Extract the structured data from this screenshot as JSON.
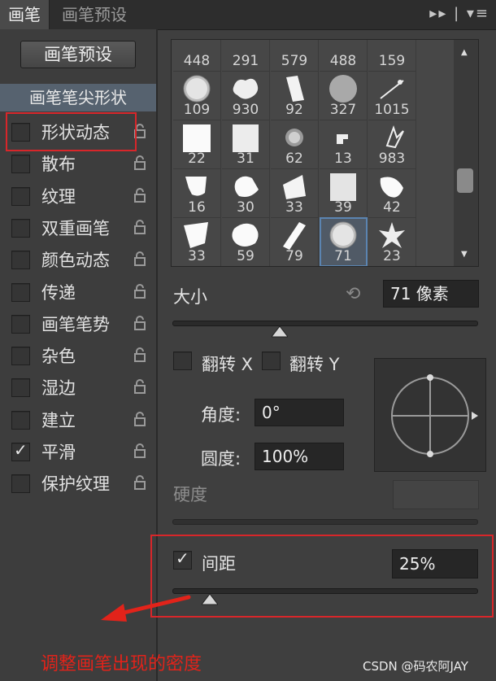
{
  "tabs": [
    "画笔",
    "画笔预设"
  ],
  "panel_controls": "▸▸ | ▾≡",
  "preset_button": "画笔预设",
  "tip_header": "画笔笔尖形状",
  "options": [
    {
      "label": "形状动态",
      "checked": false
    },
    {
      "label": "散布",
      "checked": false
    },
    {
      "label": "纹理",
      "checked": false
    },
    {
      "label": "双重画笔",
      "checked": false
    },
    {
      "label": "颜色动态",
      "checked": false
    },
    {
      "label": "传递",
      "checked": false
    },
    {
      "label": "画笔笔势",
      "checked": false
    },
    {
      "label": "杂色",
      "checked": false
    },
    {
      "label": "湿边",
      "checked": false
    },
    {
      "label": "建立",
      "checked": false
    },
    {
      "label": "平滑",
      "checked": true
    },
    {
      "label": "保护纹理",
      "checked": false
    }
  ],
  "brushes": [
    "448",
    "291",
    "579",
    "488",
    "159",
    "109",
    "930",
    "92",
    "327",
    "1015",
    "22",
    "31",
    "62",
    "13",
    "983",
    "16",
    "30",
    "33",
    "39",
    "42",
    "33",
    "59",
    "79",
    "71",
    "23"
  ],
  "selected_brush": "71",
  "size": {
    "label": "大小",
    "value": "71 像素"
  },
  "flip_x": "翻转 X",
  "flip_y": "翻转 Y",
  "angle": {
    "label": "角度:",
    "value": "0°"
  },
  "roundness": {
    "label": "圆度:",
    "value": "100%"
  },
  "hardness": {
    "label": "硬度"
  },
  "spacing": {
    "label": "间距",
    "value": "25%",
    "checked": true
  },
  "annotation": "调整画笔出现的密度",
  "watermark": "CSDN @码农阿JAY"
}
